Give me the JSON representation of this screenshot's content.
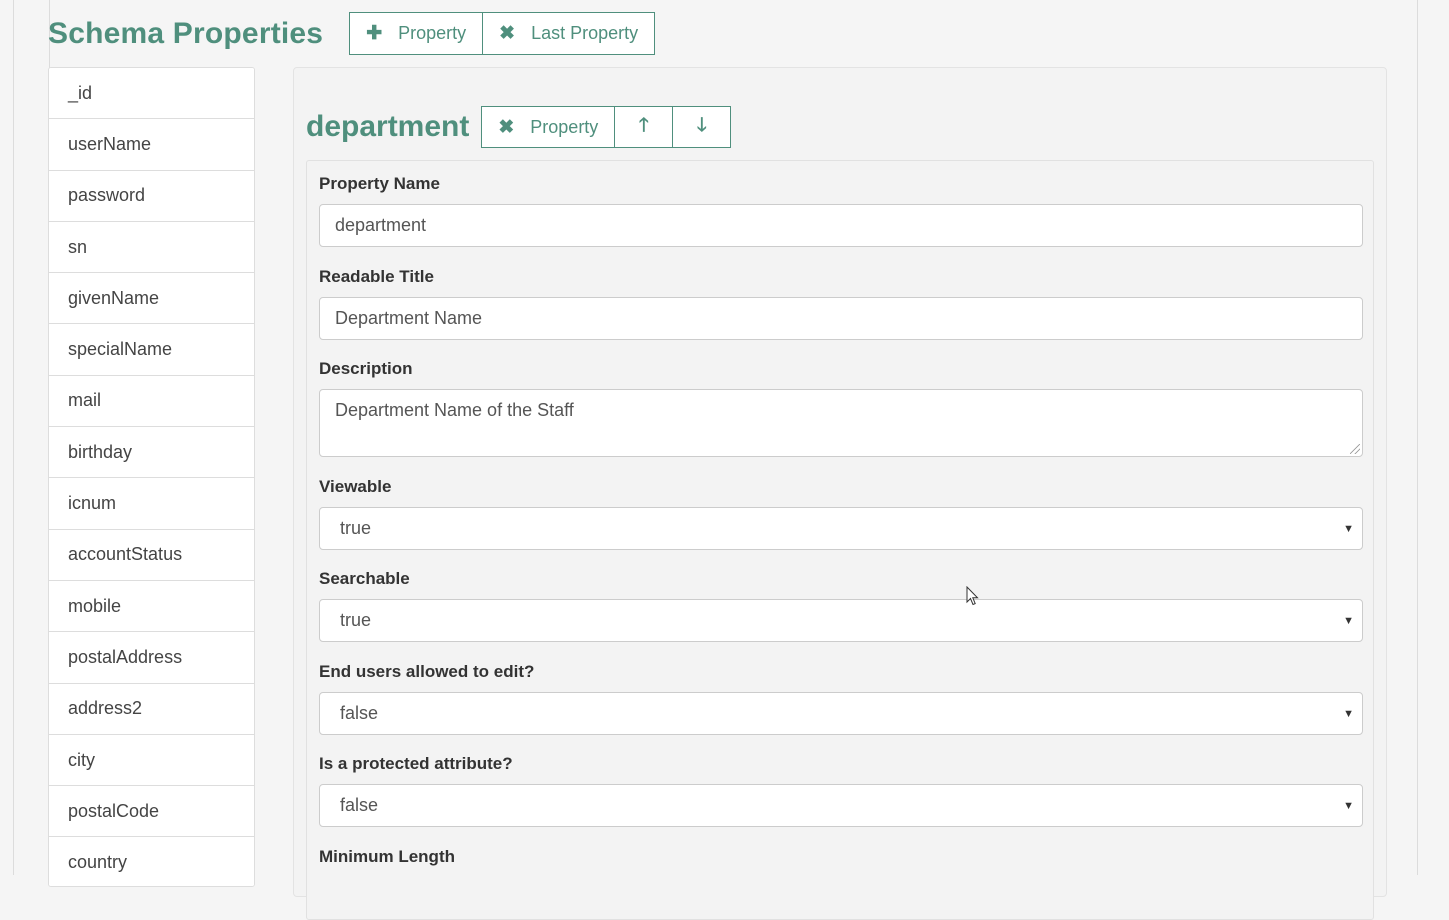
{
  "header": {
    "title": "Schema Properties",
    "add_property_label": "Property",
    "remove_last_label": "Last Property"
  },
  "sidebar": {
    "items": [
      {
        "label": "_id"
      },
      {
        "label": "userName"
      },
      {
        "label": "password"
      },
      {
        "label": "sn"
      },
      {
        "label": "givenName"
      },
      {
        "label": "specialName"
      },
      {
        "label": "mail"
      },
      {
        "label": "birthday"
      },
      {
        "label": "icnum"
      },
      {
        "label": "accountStatus"
      },
      {
        "label": "mobile"
      },
      {
        "label": "postalAddress"
      },
      {
        "label": "address2"
      },
      {
        "label": "city"
      },
      {
        "label": "postalCode"
      },
      {
        "label": "country"
      }
    ]
  },
  "property": {
    "title": "department",
    "remove_label": "Property"
  },
  "form": {
    "property_name": {
      "label": "Property Name",
      "value": "department"
    },
    "readable_title": {
      "label": "Readable Title",
      "value": "Department Name"
    },
    "description": {
      "label": "Description",
      "value": "Department Name of the Staff"
    },
    "viewable": {
      "label": "Viewable",
      "value": "true"
    },
    "searchable": {
      "label": "Searchable",
      "value": "true"
    },
    "user_editable": {
      "label": "End users allowed to edit?",
      "value": "false"
    },
    "protected": {
      "label": "Is a protected attribute?",
      "value": "false"
    },
    "min_length": {
      "label": "Minimum Length"
    }
  },
  "colors": {
    "accent": "#4f8f7d",
    "border": "#cccccc",
    "panel_bg": "#f3f3f3"
  },
  "icons": {
    "add": "plus-icon",
    "remove": "times-icon",
    "up": "arrow-up-icon",
    "down": "arrow-down-icon",
    "dropdown": "caret-down-icon"
  }
}
